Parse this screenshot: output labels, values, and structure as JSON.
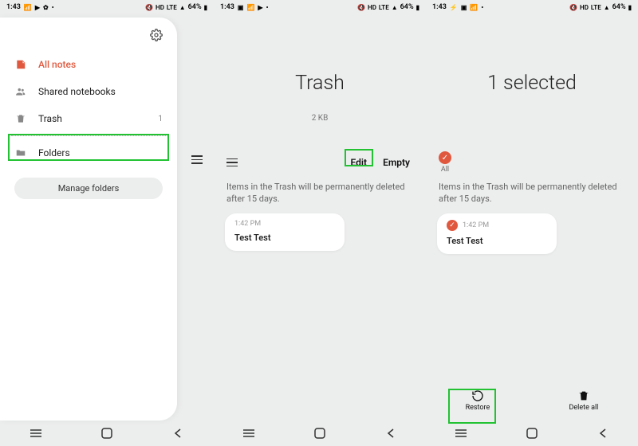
{
  "status": {
    "time": "1:43",
    "battery": "64%",
    "net": "LTE"
  },
  "pane1": {
    "menu": [
      {
        "icon": "note",
        "label": "All notes"
      },
      {
        "icon": "people",
        "label": "Shared notebooks"
      },
      {
        "icon": "trash",
        "label": "Trash",
        "count": "1"
      },
      {
        "icon": "folder",
        "label": "Folders"
      }
    ],
    "manage_label": "Manage folders"
  },
  "pane2": {
    "title": "Trash",
    "size": "2 KB",
    "edit_label": "Edit",
    "empty_label": "Empty",
    "info": "Items in the Trash will be permanently deleted after 15 days.",
    "note": {
      "time": "1:42 PM",
      "title": "Test Test"
    }
  },
  "pane3": {
    "title": "1 selected",
    "all_label": "All",
    "info": "Items in the Trash will be permanently deleted after 15 days.",
    "note": {
      "time": "1:42 PM",
      "title": "Test Test"
    },
    "restore_label": "Restore",
    "delete_all_label": "Delete all"
  }
}
